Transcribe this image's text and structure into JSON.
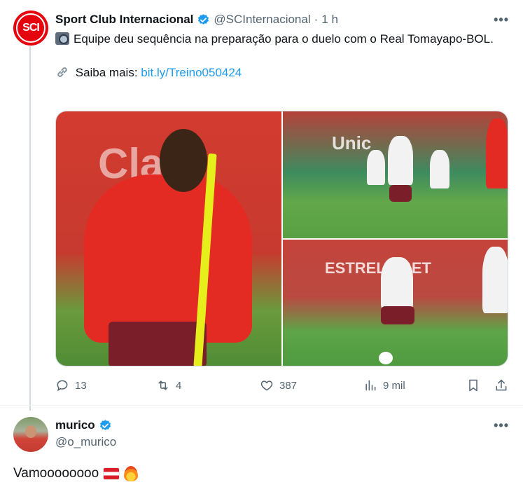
{
  "tweet": {
    "author_name": "Sport Club Internacional",
    "handle": "@SCInternacional",
    "separator": "·",
    "time": "1 h",
    "avatar_initials": "SCI",
    "text_line": "Equipe deu sequência na preparação para o duelo com o Real Tomayapo-BOL.",
    "link_prefix": "Saiba mais:",
    "link_text": "bit.ly/Treino050424",
    "more_label": "•••",
    "media": {
      "photo_big_wall_text": "Claro",
      "photo_top_right_wall_text": "Unic",
      "photo_bottom_right_wall_text": "ESTRELA BET"
    },
    "actions": {
      "replies": "13",
      "reposts": "4",
      "likes": "387",
      "views": "9 mil"
    }
  },
  "reply": {
    "author_name": "murico",
    "handle": "@o_murico",
    "more_label": "•••",
    "text": "Vamoooooooo"
  },
  "colors": {
    "verified": "#1d9bf0",
    "link": "#1d9bf0",
    "brand_red": "#e5050f",
    "secondary_text": "#536471"
  }
}
